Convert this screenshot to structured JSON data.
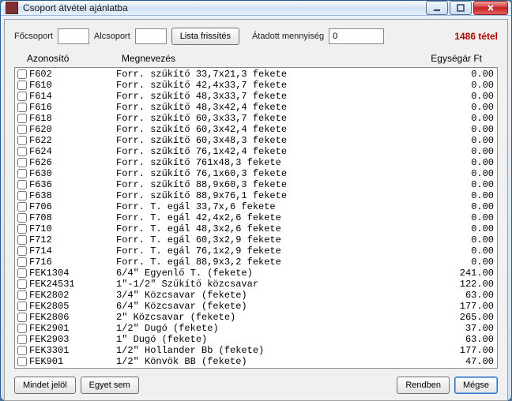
{
  "window": {
    "title": "Csoport átvétel ajánlatba"
  },
  "toolbar": {
    "focscsoport_label": "Főcsoport",
    "focscsoport_value": "",
    "alcscsoport_label": "Alcsoport",
    "alcscsoport_value": "",
    "refresh_label": "Lista frissítés",
    "qty_label": "Átadott mennyiség",
    "qty_value": "0",
    "count_text": "1486 tétel"
  },
  "columns": {
    "id": "Azonosító",
    "name": "Megnevezés",
    "price": "Egységár  Ft"
  },
  "rows": [
    {
      "id": "F602",
      "name": "Forr. szűkítő 33,7x21,3 fekete",
      "price": "0.00"
    },
    {
      "id": "F610",
      "name": "Forr. szűkítő 42,4x33,7 fekete",
      "price": "0.00"
    },
    {
      "id": "F614",
      "name": "Forr. szűkítő 48,3x33,7 fekete",
      "price": "0.00"
    },
    {
      "id": "F616",
      "name": "Forr. szűkítő 48,3x42,4 fekete",
      "price": "0.00"
    },
    {
      "id": "F618",
      "name": "Forr. szűkítő 60,3x33,7 fekete",
      "price": "0.00"
    },
    {
      "id": "F620",
      "name": "Forr. szűkítő 60,3x42,4 fekete",
      "price": "0.00"
    },
    {
      "id": "F622",
      "name": "Forr. szűkítő 60,3x48,3 fekete",
      "price": "0.00"
    },
    {
      "id": "F624",
      "name": "Forr. szűkítő 76,1x42,4 fekete",
      "price": "0.00"
    },
    {
      "id": "F626",
      "name": "Forr. szűkítő 761x48,3 fekete",
      "price": "0.00"
    },
    {
      "id": "F630",
      "name": "Forr. szűkítő 76,1x60,3 fekete",
      "price": "0.00"
    },
    {
      "id": "F636",
      "name": "Forr. szűkítő 88,9x60,3 fekete",
      "price": "0.00"
    },
    {
      "id": "F638",
      "name": "Forr. szűkítő 88,9x76,1 fekete",
      "price": "0.00"
    },
    {
      "id": "F706",
      "name": "Forr. T. egál 33,7x,6 fekete",
      "price": "0.00"
    },
    {
      "id": "F708",
      "name": "Forr. T. egál 42,4x2,6 fekete",
      "price": "0.00"
    },
    {
      "id": "F710",
      "name": "Forr. T. egál 48,3x2,6 fekete",
      "price": "0.00"
    },
    {
      "id": "F712",
      "name": "Forr. T. egál 60,3x2,9 fekete",
      "price": "0.00"
    },
    {
      "id": "F714",
      "name": "Forr. T. egál 76,1x2,9 fekete",
      "price": "0.00"
    },
    {
      "id": "F716",
      "name": "Forr. T. egál 88,9x3,2 fekete",
      "price": "0.00"
    },
    {
      "id": "FEK1304",
      "name": "6/4\" Egyenlő T. (fekete)",
      "price": "241.00"
    },
    {
      "id": "FEK24531",
      "name": "1\"-1/2\" Szűkítő közcsavar",
      "price": "122.00"
    },
    {
      "id": "FEK2802",
      "name": "3/4\" Közcsavar (fekete)",
      "price": "63.00"
    },
    {
      "id": "FEK2805",
      "name": "6/4\" Közcsavar (fekete)",
      "price": "177.00"
    },
    {
      "id": "FEK2806",
      "name": "2\" Közcsavar (fekete)",
      "price": "265.00"
    },
    {
      "id": "FEK2901",
      "name": "1/2\" Dugó (fekete)",
      "price": "37.00"
    },
    {
      "id": "FEK2903",
      "name": "1\" Dugó (fekete)",
      "price": "63.00"
    },
    {
      "id": "FEK3301",
      "name": "1/2\" Hollander Bb (fekete)",
      "price": "177.00"
    },
    {
      "id": "FEK901",
      "name": "1/2\" Könvök BB (fekete)",
      "price": "47.00"
    }
  ],
  "buttons": {
    "select_all": "Mindet jelöl",
    "select_none": "Egyet sem",
    "ok": "Rendben",
    "cancel": "Mégse"
  }
}
